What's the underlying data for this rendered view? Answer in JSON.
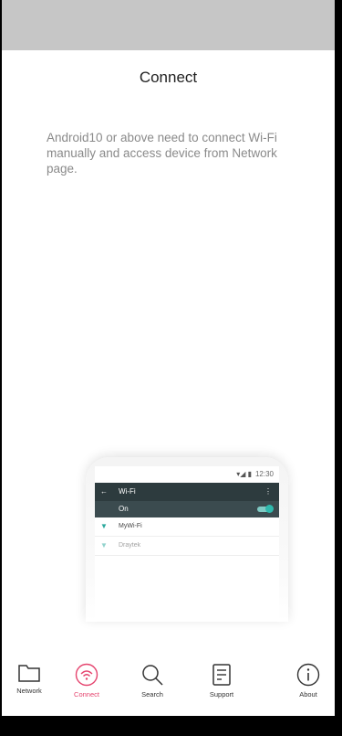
{
  "header": {
    "title": "Connect"
  },
  "message": "Android10 or above need to connect Wi-Fi manually and access device from Network page.",
  "illustration": {
    "time": "12:30",
    "wifi_title": "Wi-Fi",
    "wifi_state": "On",
    "networks": [
      "MyWi-Fi",
      "Draytek"
    ]
  },
  "tabs": [
    {
      "label": "Network",
      "icon": "folder-icon"
    },
    {
      "label": "Connect",
      "icon": "wifi-icon",
      "active": true
    },
    {
      "label": "Search",
      "icon": "search-icon"
    },
    {
      "label": "Support",
      "icon": "document-icon"
    },
    {
      "label": "About",
      "icon": "info-icon"
    }
  ],
  "colors": {
    "accent": "#e5446e",
    "status_bar": "#c6c6c6",
    "teal": "#2fb9ad"
  }
}
